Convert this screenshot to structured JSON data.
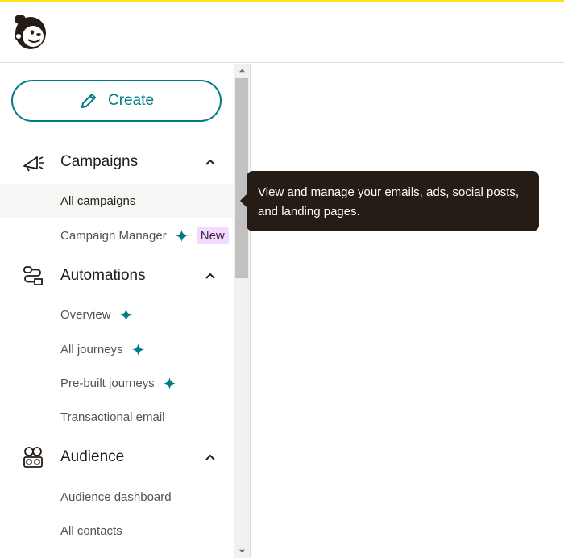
{
  "brand": {
    "logo_icon": "mailchimp-freddie-logo",
    "accent_color": "#ffe01b",
    "primary_color": "#007c89"
  },
  "create_button": {
    "label": "Create",
    "icon": "pencil-icon"
  },
  "nav": {
    "campaigns": {
      "label": "Campaigns",
      "icon": "megaphone-icon",
      "expanded": true,
      "items": [
        {
          "label": "All campaigns",
          "active": true
        },
        {
          "label": "Campaign Manager",
          "sparkle": true,
          "badge": "New"
        }
      ]
    },
    "automations": {
      "label": "Automations",
      "icon": "automation-flow-icon",
      "expanded": true,
      "items": [
        {
          "label": "Overview",
          "sparkle": true
        },
        {
          "label": "All journeys",
          "sparkle": true
        },
        {
          "label": "Pre-built journeys",
          "sparkle": true
        },
        {
          "label": "Transactional email"
        }
      ]
    },
    "audience": {
      "label": "Audience",
      "icon": "audience-icon",
      "expanded": true,
      "items": [
        {
          "label": "Audience dashboard"
        },
        {
          "label": "All contacts"
        }
      ]
    }
  },
  "tooltip": {
    "text": "View and manage your emails, ads, social posts, and landing pages."
  },
  "colors": {
    "sparkle": "#007c89",
    "badge_bg": "#f5d9ff",
    "tooltip_bg": "#241c15"
  }
}
